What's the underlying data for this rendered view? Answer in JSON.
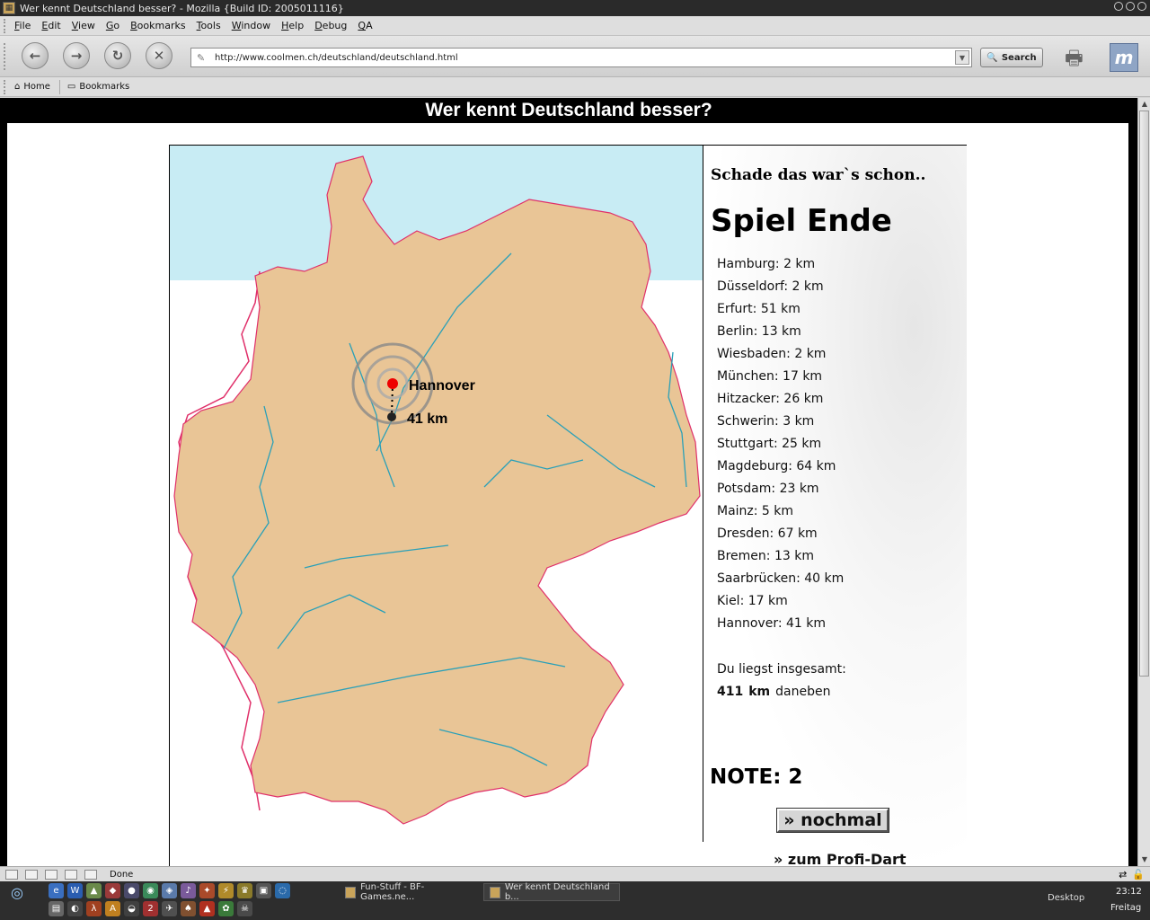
{
  "window": {
    "title": "Wer kennt Deutschland besser? - Mozilla {Build ID: 2005011116}"
  },
  "menu": [
    {
      "label": "File",
      "key": "F",
      "rest": "ile"
    },
    {
      "label": "Edit",
      "key": "E",
      "rest": "dit"
    },
    {
      "label": "View",
      "key": "V",
      "rest": "iew"
    },
    {
      "label": "Go",
      "key": "G",
      "rest": "o"
    },
    {
      "label": "Bookmarks",
      "key": "B",
      "rest": "ookmarks"
    },
    {
      "label": "Tools",
      "key": "T",
      "rest": "ools"
    },
    {
      "label": "Window",
      "key": "W",
      "rest": "indow"
    },
    {
      "label": "Help",
      "key": "H",
      "rest": "elp"
    },
    {
      "label": "Debug",
      "key": "D",
      "rest": "ebug"
    },
    {
      "label": "QA",
      "key": "Q",
      "rest": "A"
    }
  ],
  "nav": {
    "url": "http://www.coolmen.ch/deutschland/deutschland.html",
    "search_label": "Search"
  },
  "personal": {
    "home": "Home",
    "bookmarks": "Bookmarks"
  },
  "page": {
    "heading": "Wer kennt Deutschland besser?",
    "message": "Schade das war`s schon..",
    "end_title": "Spiel Ende",
    "results": [
      "Hamburg: 2 km",
      "Düsseldorf: 2 km",
      "Erfurt: 51 km",
      "Berlin: 13 km",
      "Wiesbaden: 2 km",
      "München: 17 km",
      "Hitzacker: 26 km",
      "Schwerin: 3 km",
      "Stuttgart: 25 km",
      "Magdeburg: 64 km",
      "Potsdam: 23 km",
      "Mainz: 5 km",
      "Dresden: 67 km",
      "Bremen: 13 km",
      "Saarbrücken: 40 km",
      "Kiel: 17 km",
      "Hannover: 41 km"
    ],
    "total_label": "Du liegst insgesamt:",
    "total_value": "411",
    "total_unit": "km",
    "total_suffix": "daneben",
    "grade": "NOTE: 2",
    "again_button": "» nochmal",
    "profi_link": "» zum Profi-Dart",
    "map": {
      "city_label": "Hannover",
      "distance_label": "41 km",
      "land_color": "#e9c596",
      "sea_color": "#c8ecf4",
      "river_color": "#2aa0b8",
      "border_color": "#e0306a"
    }
  },
  "status": {
    "text": "Done"
  },
  "taskbar": {
    "tasks": [
      "Fun-Stuff - BF-Games.ne...",
      "Wer kennt Deutschland b..."
    ],
    "desktop": "Desktop",
    "time": "23:12",
    "day": "Freitag"
  }
}
